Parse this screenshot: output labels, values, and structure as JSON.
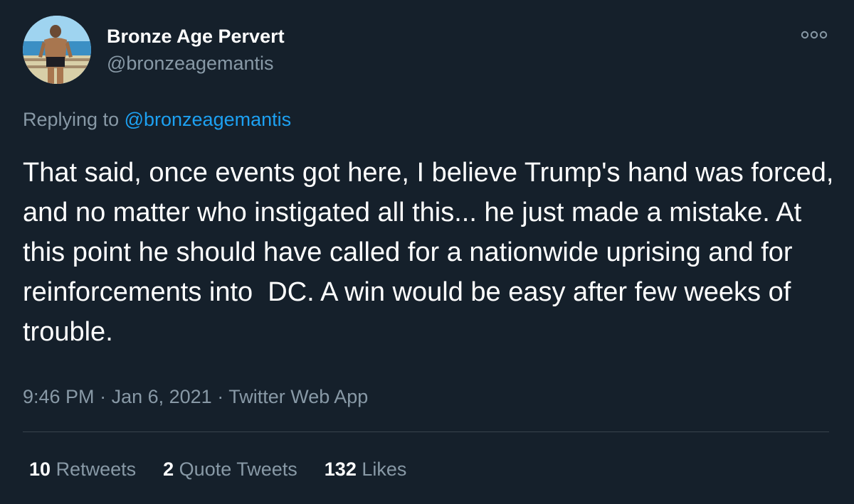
{
  "author": {
    "name": "Bronze Age Pervert",
    "handle": "@bronzeagemantis",
    "avatar_icon": "profile-photo-beach"
  },
  "reply": {
    "prefix": "Replying to ",
    "handle": "@bronzeagemantis"
  },
  "tweet": {
    "text": "That said, once events got here, I believe Trump's hand was forced, and no matter who instigated all this... he just made a mistake. At this point he should have called for a nationwide uprising and for reinforcements into  DC. A win would be easy after few weeks of trouble."
  },
  "meta": {
    "time": "9:46 PM",
    "separator": " · ",
    "date": "Jan 6, 2021",
    "source": "Twitter Web App"
  },
  "stats": {
    "retweets_count": "10",
    "retweets_label": "Retweets",
    "quotes_count": "2",
    "quotes_label": "Quote Tweets",
    "likes_count": "132",
    "likes_label": "Likes"
  },
  "colors": {
    "background": "#15202b",
    "text": "#ffffff",
    "secondary": "#8899a6",
    "link": "#1da1f2",
    "divider": "#38444d"
  },
  "icons": {
    "more": "more-options-icon"
  }
}
